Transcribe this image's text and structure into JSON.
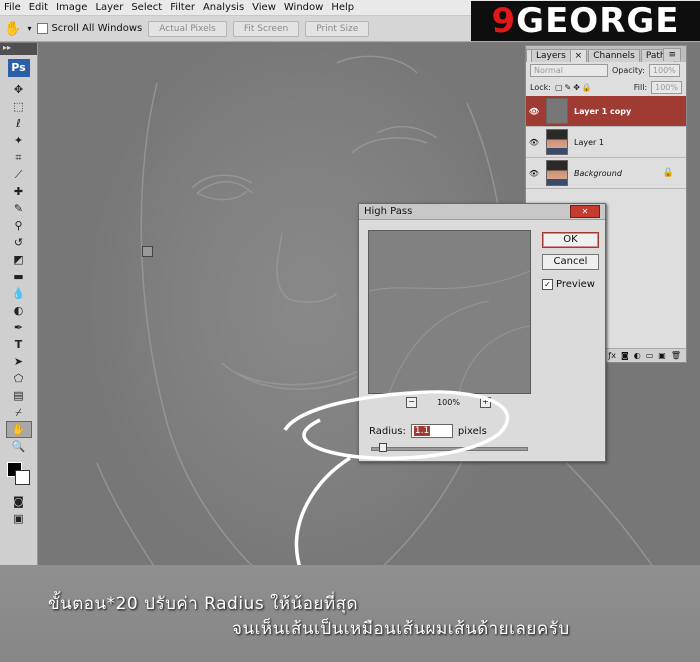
{
  "menu": [
    "File",
    "Edit",
    "Image",
    "Layer",
    "Select",
    "Filter",
    "Analysis",
    "View",
    "Window",
    "Help"
  ],
  "options_bar": {
    "scroll_all_windows": "Scroll All Windows",
    "actual_pixels": "Actual Pixels",
    "fit_screen": "Fit Screen",
    "print_size": "Print Size"
  },
  "logo": {
    "nine": "9",
    "rest": "GEORGE"
  },
  "toolbox": {
    "app_badge": "Ps",
    "type_tool_glyph": "T"
  },
  "layers_panel": {
    "tabs": [
      "Layers",
      "Channels",
      "Paths"
    ],
    "blend_mode": "Normal",
    "opacity_label": "Opacity:",
    "opacity_value": "100%",
    "lock_label": "Lock:",
    "fill_label": "Fill:",
    "fill_value": "100%",
    "layers": [
      {
        "name": "Layer 1 copy",
        "selected": true
      },
      {
        "name": "Layer 1",
        "selected": false
      },
      {
        "name": "Background",
        "selected": false
      }
    ]
  },
  "high_pass_dialog": {
    "title": "High Pass",
    "ok": "OK",
    "cancel": "Cancel",
    "preview_label": "Preview",
    "preview_checked": true,
    "zoom": "100%",
    "radius_label": "Radius:",
    "radius_value": "1.1",
    "radius_unit": "pixels"
  },
  "caption": {
    "line1": "ขั้นตอน*20  ปรับค่า Radius ให้น้อยที่สุด",
    "line2": "จนเห็นเส้นเป็นเหมือนเส้นผมเส้นด้ายเลยครับ"
  },
  "colors": {
    "selected_layer": "#a03b34",
    "logo_accent": "#e01818",
    "canvas": "#7d7d7d"
  }
}
